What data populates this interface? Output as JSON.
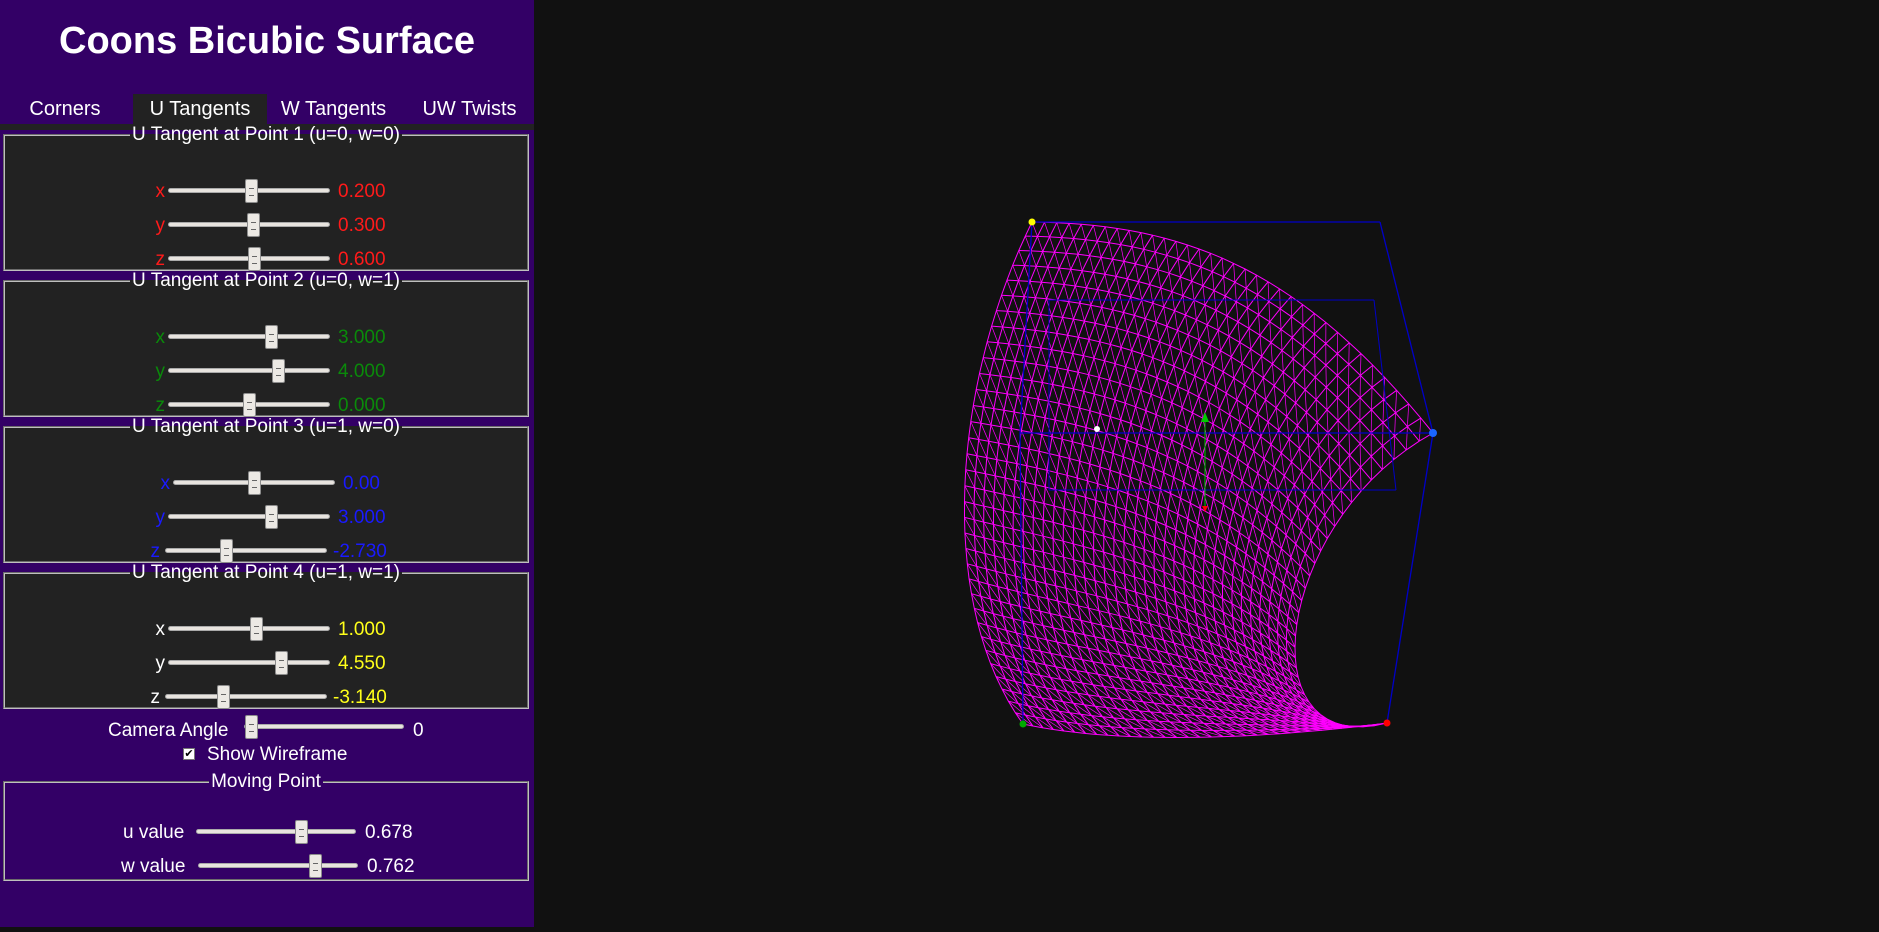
{
  "title": "Coons Bicubic Surface",
  "tabs": [
    {
      "label": "Corners",
      "active": false
    },
    {
      "label": "U Tangents",
      "active": true
    },
    {
      "label": "W Tangents",
      "active": false
    },
    {
      "label": "UW Twists",
      "active": false
    }
  ],
  "groups": [
    {
      "legend": "U Tangent at Point 1 (u=0, w=0)",
      "color": "#ff1a1a",
      "rows": [
        {
          "label": "x",
          "value": "0.200",
          "fraction": 0.52
        },
        {
          "label": "y",
          "value": "0.300",
          "fraction": 0.53
        },
        {
          "label": "z",
          "value": "0.600",
          "fraction": 0.54
        }
      ]
    },
    {
      "legend": "U Tangent at Point 2 (u=0, w=1)",
      "color": "#0a8a0a",
      "rows": [
        {
          "label": "x",
          "value": "3.000",
          "fraction": 0.65
        },
        {
          "label": "y",
          "value": "4.000",
          "fraction": 0.7
        },
        {
          "label": "z",
          "value": "0.000",
          "fraction": 0.5
        }
      ]
    },
    {
      "legend": "U Tangent at Point 3 (u=1, w=0)",
      "color": "#1a1aff",
      "rows": [
        {
          "label": "x",
          "value": "0.00",
          "fraction": 0.5
        },
        {
          "label": "y",
          "value": "3.000",
          "fraction": 0.65
        },
        {
          "label": "z",
          "value": "-2.730",
          "fraction": 0.37
        }
      ]
    },
    {
      "legend": "U Tangent at Point 4 (u=1, w=1)",
      "color": "#ffff1a",
      "rows": [
        {
          "label": "x",
          "value": "1.000",
          "fraction": 0.55
        },
        {
          "label": "y",
          "value": "4.550",
          "fraction": 0.72
        },
        {
          "label": "z",
          "value": "-3.140",
          "fraction": 0.35
        }
      ]
    }
  ],
  "camera": {
    "label": "Camera Angle",
    "value": "0",
    "fraction": 0.0
  },
  "wireframe": {
    "label": "Show Wireframe",
    "checked": true,
    "check_glyph": "✔"
  },
  "moving_point": {
    "legend": "Moving Point",
    "rows": [
      {
        "label": "u value",
        "value": "0.678",
        "fraction": 0.678
      },
      {
        "label": "w value",
        "value": "0.762",
        "fraction": 0.762
      }
    ]
  },
  "scene": {
    "surface_color": "#ff00ff",
    "frame_color": "#0000c8",
    "corner_colors": {
      "p00": "#ffff00",
      "p10": "#1a66ff",
      "p01": "#00aa00",
      "p11": "#ff0000"
    },
    "axis_colors": {
      "x": "#ff0000",
      "y": "#00cc00"
    },
    "moving_point_color": "#ffffff"
  }
}
